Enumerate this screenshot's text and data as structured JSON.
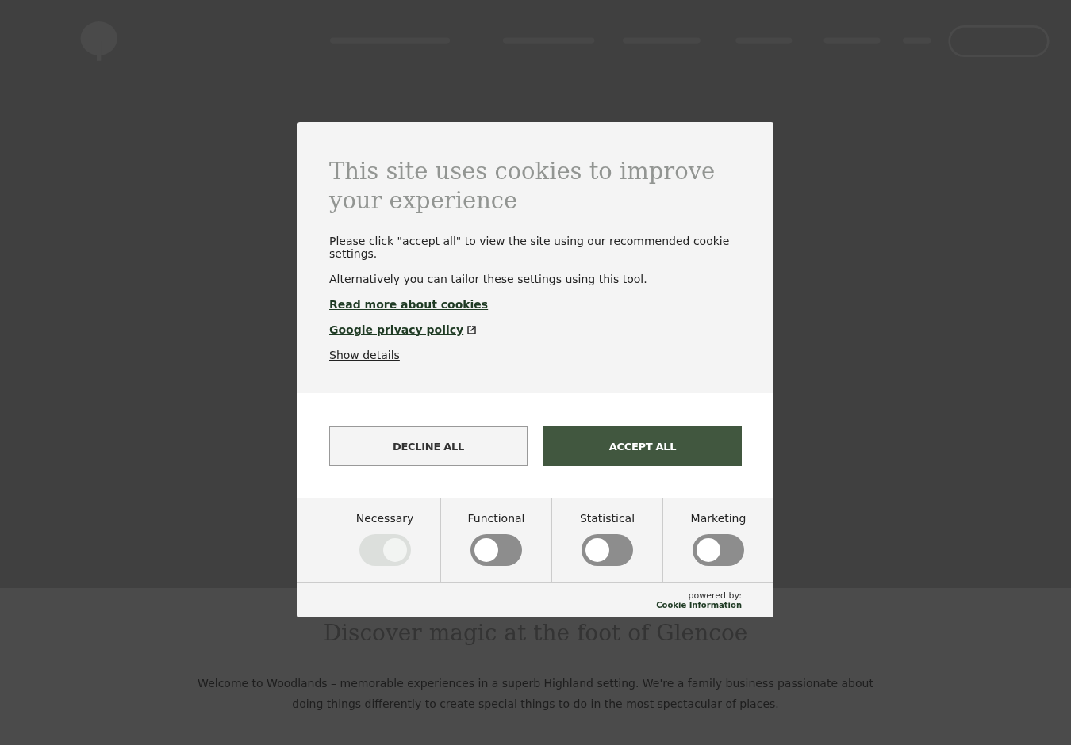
{
  "dialog": {
    "title": "This site uses cookies to improve your experience",
    "paragraphs": [
      "Please click \"accept all\" to view the site using our recommended cookie settings.",
      "Alternatively you can tailor these settings using this tool."
    ],
    "links": [
      {
        "label": "Read more about cookies",
        "external": false
      },
      {
        "label": "Google privacy policy",
        "external": true
      }
    ],
    "details_link": "Show details",
    "buttons": [
      {
        "label": "DECLINE ALL",
        "kind": "secondary"
      },
      {
        "label": "ACCEPT ALL",
        "kind": "primary"
      }
    ],
    "categories": [
      {
        "label": "Necessary",
        "checked": true,
        "disabled": true
      },
      {
        "label": "Functional",
        "checked": false,
        "disabled": false
      },
      {
        "label": "Statistical",
        "checked": false,
        "disabled": false
      },
      {
        "label": "Marketing",
        "checked": false,
        "disabled": false
      }
    ],
    "powered_by": "powered by:",
    "provider_link": "Cookie Information"
  },
  "page": {
    "heading": "Discover magic at the foot of Glencoe",
    "intro": "Welcome to Woodlands – memorable experiences in a superb Highland setting.  We're a family business passionate about doing things differently to create special things to do in the most spectacular of places."
  }
}
